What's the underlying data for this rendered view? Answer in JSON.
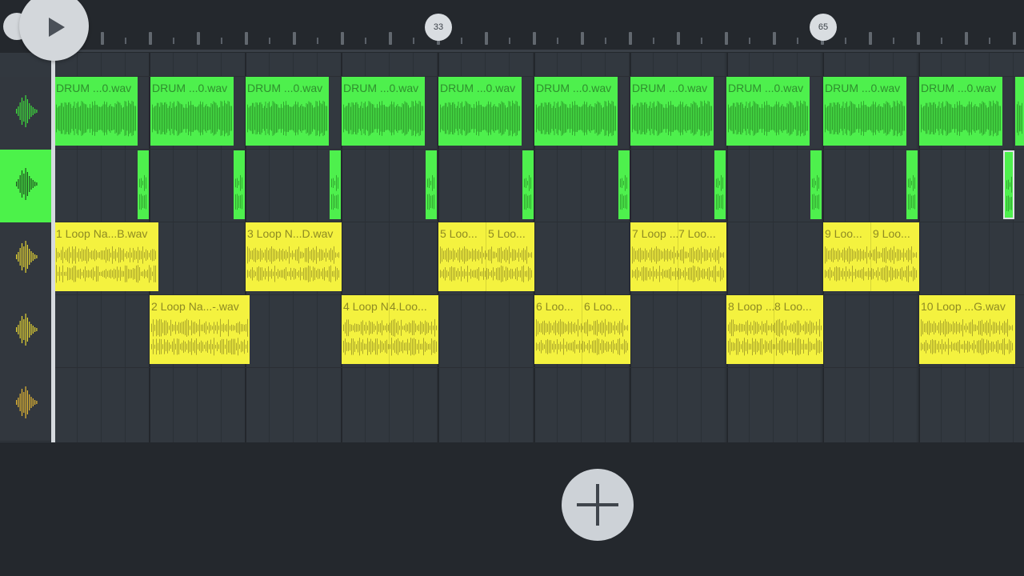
{
  "ruler": {
    "markers": [
      "33",
      "65"
    ]
  },
  "transport": {
    "play_icon": "play-icon"
  },
  "tracks": [
    {
      "icon": "waveform-icon",
      "color": "#3ee23c",
      "active": false
    },
    {
      "icon": "waveform-icon",
      "color": "#1f4f20",
      "active": true
    },
    {
      "icon": "waveform-icon",
      "color": "#e7d633",
      "active": false
    },
    {
      "icon": "waveform-icon",
      "color": "#e7d633",
      "active": false
    },
    {
      "icon": "waveform-icon",
      "color": "#e6b833",
      "active": false
    }
  ],
  "clips": {
    "drum": [
      "DRUM ...0.wav",
      "DRUM ...0.wav",
      "DRUM ...0.wav",
      "DRUM ...0.wav",
      "DRUM ...0.wav",
      "DRUM ...0.wav",
      "DRUM ...0.wav",
      "DRUM ...0.wav",
      "DRUM ...0.wav",
      "DRUM ...0.wav"
    ],
    "loops_row3": [
      "1 Loop Na...B.wav",
      "3 Loop N...D.wav",
      "5 Loo...",
      "5 Loo...",
      "7 Loop ...",
      "7 Loo...",
      "9 Loo...",
      "9 Loo..."
    ],
    "loops_row4": [
      "2 Loop Na...-.wav",
      "4 Loop N",
      "4.Loo...",
      "6 Loo...",
      "6 Loo...",
      "8 Loop ...",
      "8 Loo...",
      "10 Loop ...G.wav"
    ]
  },
  "add_button": {
    "icon": "plus-icon"
  },
  "colors": {
    "clip_green": "#4ef04d",
    "clip_yellow": "#f4f23f",
    "background": "#24282d",
    "track_bg": "#32383f"
  }
}
